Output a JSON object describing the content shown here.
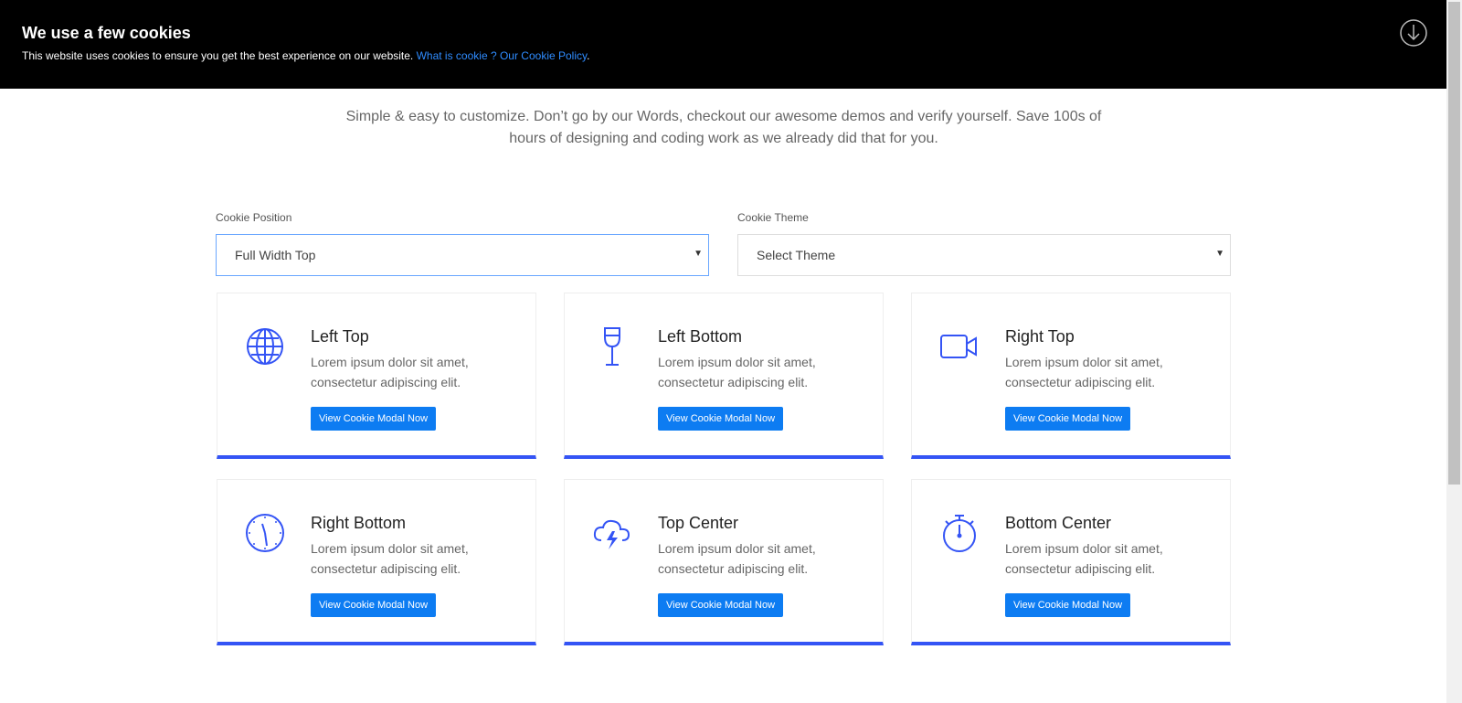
{
  "cookie_banner": {
    "title": "We use a few cookies",
    "text": "This website uses cookies to ensure you get the best experience on our website.",
    "link_text": "What is cookie ? Our Cookie Policy",
    "link_suffix": ".",
    "accept_icon": "download-circle-icon"
  },
  "intro": {
    "line1": "Simple & easy to customize. Don’t go by our Words, checkout our awesome demos and verify yourself. Save 100s of",
    "line2": "hours of designing and coding work as we already did that for you."
  },
  "controls": {
    "position_label": "Cookie Position",
    "position_value": "Full Width Top",
    "theme_label": "Cookie Theme",
    "theme_value": "Select Theme"
  },
  "cards": [
    {
      "icon": "globe-icon",
      "title": "Left Top",
      "desc1": "Lorem ipsum dolor sit amet,",
      "desc2": "consectetur adipiscing elit.",
      "button": "View Cookie Modal Now"
    },
    {
      "icon": "wine-glass-icon",
      "title": "Left Bottom",
      "desc1": "Lorem ipsum dolor sit amet,",
      "desc2": "consectetur adipiscing elit.",
      "button": "View Cookie Modal Now"
    },
    {
      "icon": "video-camera-icon",
      "title": "Right Top",
      "desc1": "Lorem ipsum dolor sit amet,",
      "desc2": "consectetur adipiscing elit.",
      "button": "View Cookie Modal Now"
    },
    {
      "icon": "clock-icon",
      "title": "Right Bottom",
      "desc1": "Lorem ipsum dolor sit amet,",
      "desc2": "consectetur adipiscing elit.",
      "button": "View Cookie Modal Now"
    },
    {
      "icon": "storm-cloud-icon",
      "title": "Top Center",
      "desc1": "Lorem ipsum dolor sit amet,",
      "desc2": "consectetur adipiscing elit.",
      "button": "View Cookie Modal Now"
    },
    {
      "icon": "stopwatch-icon",
      "title": "Bottom Center",
      "desc1": "Lorem ipsum dolor sit amet,",
      "desc2": "consectetur adipiscing elit.",
      "button": "View Cookie Modal Now"
    }
  ],
  "colors": {
    "accent": "#3454f5",
    "button": "#0d7cf2",
    "banner_bg": "#000000",
    "link": "#2f8cff"
  }
}
